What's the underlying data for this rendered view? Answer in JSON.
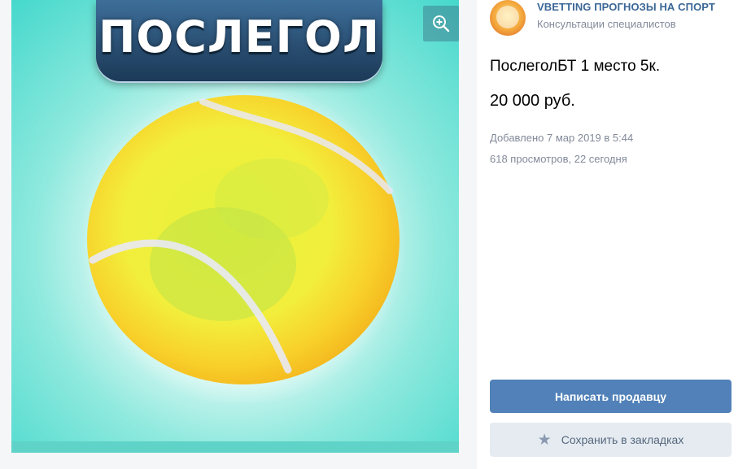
{
  "image": {
    "banner_text": "ПОСЛЕГОЛ",
    "zoom_icon": "zoom-in-icon",
    "colors": {
      "background": "#45d8cc",
      "ball": "#f2ef3c",
      "banner": "#2a4f73"
    }
  },
  "seller": {
    "name": "VBETTING ПРОГНОЗЫ НА СПОРТ",
    "subtitle": "Консультации специалистов"
  },
  "product": {
    "title": "ПослеголБТ 1 место 5к.",
    "price": "20 000 руб.",
    "added": "Добавлено 7 мар 2019 в 5:44",
    "views": "618 просмотров, 22 сегодня"
  },
  "actions": {
    "write_seller": "Написать продавцу",
    "save_bookmark": "Сохранить в закладках",
    "save_icon": "star-icon"
  },
  "colors": {
    "accent": "#5181b8",
    "link": "#3b6796",
    "muted_text": "#828a99",
    "secondary_button": "#e5ebf1"
  }
}
